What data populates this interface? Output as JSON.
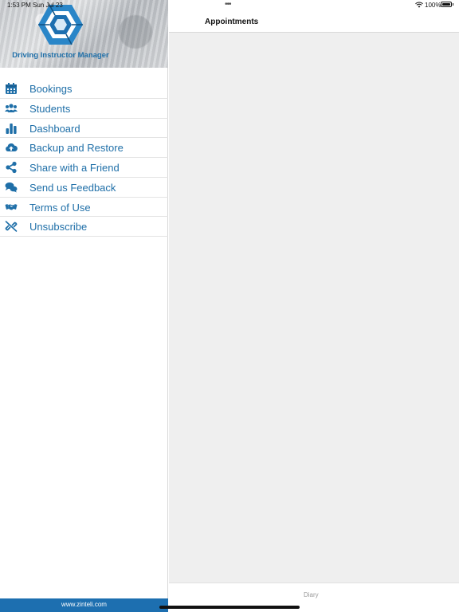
{
  "status_bar": {
    "time": "1:53 PM",
    "date": "Sun Jul 23",
    "battery": "100%",
    "icons": [
      "multitasking-dots-icon",
      "wifi-icon",
      "battery-icon"
    ]
  },
  "sidebar": {
    "app_name": "Driving Instructor Manager",
    "logo_icon": "hexagon-logo-icon",
    "accent_color": "#1f6fa8",
    "items": [
      {
        "label": "Bookings",
        "icon": "calendar-icon"
      },
      {
        "label": "Students",
        "icon": "users-icon"
      },
      {
        "label": "Dashboard",
        "icon": "bar-chart-icon"
      },
      {
        "label": "Backup and Restore",
        "icon": "cloud-upload-icon"
      },
      {
        "label": "Share with a Friend",
        "icon": "share-icon"
      },
      {
        "label": "Send us Feedback",
        "icon": "comments-icon"
      },
      {
        "label": "Terms of Use",
        "icon": "handshake-icon"
      },
      {
        "label": "Unsubscribe",
        "icon": "unlink-icon"
      }
    ],
    "footer": "www.zinteli.com",
    "footer_color": "#1d6fb0"
  },
  "main": {
    "title": "Appointments",
    "tab_label": "Diary"
  }
}
